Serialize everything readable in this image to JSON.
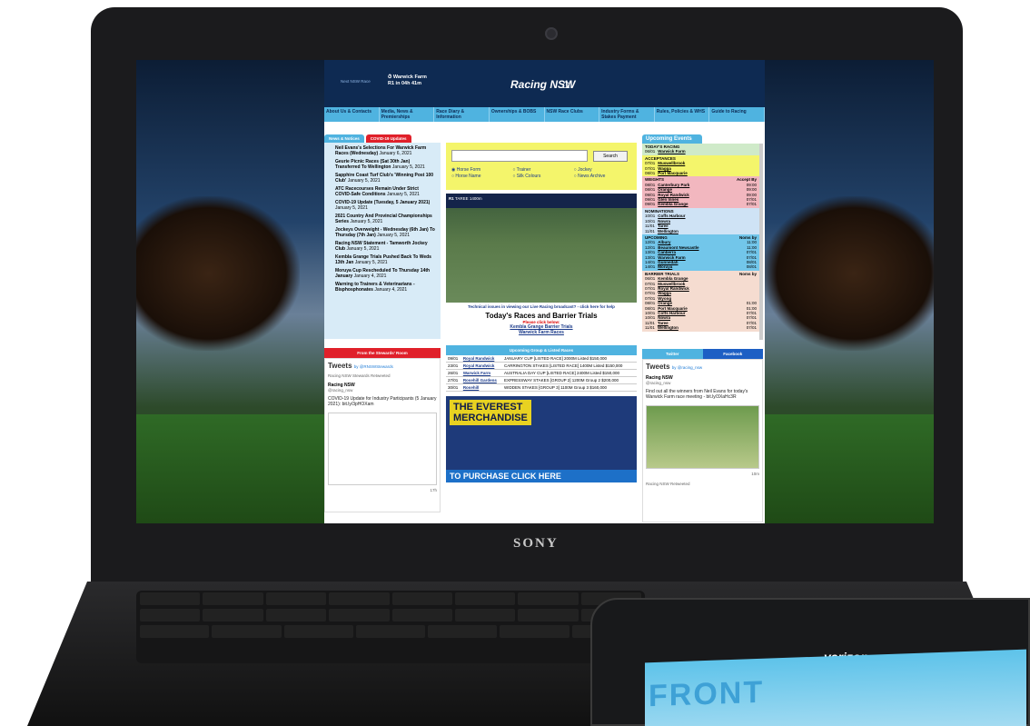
{
  "hardware": {
    "brand": "SONY",
    "carrier": "verizon",
    "phone_screen_text": "FRONT"
  },
  "header": {
    "next_race_label": "Next NSW Race",
    "next_race_venue": "Warwick Farm",
    "next_race_time": "R1 in 04h 41m",
    "logo_text": "Racing NSW"
  },
  "nav": [
    "About Us & Contacts",
    "Media, News & Premierships",
    "Race Diary & Information",
    "Ownerships & BOBS",
    "NSW Race Clubs",
    "Industry Forms & Stakes Payment",
    "Rules, Policies & WHS",
    "Guide to Racing"
  ],
  "news": {
    "tabs": [
      "News & Notices",
      "COVID-19 Updates"
    ],
    "items": [
      {
        "title": "Neil Evans's Selections For Warwick Farm Races (Wednesday)",
        "date": "January 6, 2021"
      },
      {
        "title": "Geurie Picnic Races (Sat 30th Jan) Transferred To Wellington",
        "date": "January 5, 2021"
      },
      {
        "title": "Sapphire Coast Turf Club's 'Winning Post 100 Club'",
        "date": "January 5, 2021"
      },
      {
        "title": "ATC Racecourses Remain Under Strict COVID-Safe Conditions",
        "date": "January 5, 2021"
      },
      {
        "title": "COVID-19 Update (Tuesday, 5 January 2021)",
        "date": "January 5, 2021"
      },
      {
        "title": "2021 Country And Provincial Championships Series",
        "date": "January 5, 2021"
      },
      {
        "title": "Jockeys Overweight - Wednesday (6th Jan) To Thursday (7th Jan)",
        "date": "January 5, 2021"
      },
      {
        "title": "Racing NSW Statement - Tamworth Jockey Club",
        "date": "January 5, 2021"
      },
      {
        "title": "Kembla Grange Trials Pushed Back To Weds 13th Jan",
        "date": "January 5, 2021"
      },
      {
        "title": "Moruya Cup Rescheduled To Thursday 14th January",
        "date": "January 4, 2021"
      },
      {
        "title": "Warning to Trainers & Veterinarians - Bisphosphonates",
        "date": "January 4, 2021"
      }
    ]
  },
  "search": {
    "button": "Search",
    "options": [
      "Horse Form",
      "Trainer",
      "Jockey",
      "Horse Name",
      "Silk Colours",
      "News Archive"
    ]
  },
  "video": {
    "race_label": "R1",
    "track": "TAREE",
    "distance": "1400m"
  },
  "live": {
    "notice": "Technical issues in viewing our Live Racing broadcast? - click here for help",
    "title": "Today's Races and Barrier Trials",
    "sub": "Please click below:",
    "links": [
      "Kembla Grange Barrier Trials",
      "Warwick Farm Races"
    ]
  },
  "upcoming": {
    "heading": "Upcoming Events",
    "sections": [
      {
        "name": "TODAY'S RACING",
        "right": "",
        "color": "#cfeac9",
        "rows": [
          [
            "06/01",
            "Warwick Farm",
            ""
          ]
        ]
      },
      {
        "name": "ACCEPTANCES",
        "right": "",
        "color": "#f4f56b",
        "rows": [
          [
            "07/01",
            "Muswellbrook",
            ""
          ],
          [
            "07/01",
            "Wagga",
            ""
          ],
          [
            "08/01",
            "Port Macquarie",
            ""
          ]
        ]
      },
      {
        "name": "WEIGHTS",
        "right": "Accept By",
        "color": "#f2b7bf",
        "rows": [
          [
            "08/01",
            "Canterbury Park",
            "09:00"
          ],
          [
            "08/01",
            "Orange",
            "09:00"
          ],
          [
            "09/01",
            "Royal Randwick",
            "09:00"
          ],
          [
            "09/01",
            "Glen Innes",
            "07/01"
          ],
          [
            "09/01",
            "Kembla Grange",
            "07/01"
          ]
        ]
      },
      {
        "name": "NOMINATIONS",
        "right": "",
        "color": "#cfe3f5",
        "rows": [
          [
            "10/01",
            "Coffs Harbour",
            ""
          ],
          [
            "10/01",
            "Nowra",
            ""
          ],
          [
            "11/01",
            "Taree",
            ""
          ],
          [
            "11/01",
            "Wellington",
            ""
          ]
        ]
      },
      {
        "name": "UPCOMING",
        "right": "Noms by",
        "color": "#72c6ea",
        "rows": [
          [
            "12/01",
            "Albury",
            "11:00"
          ],
          [
            "12/01",
            "Beaumont Newcastle",
            "11:00"
          ],
          [
            "13/01",
            "Canberra",
            "07/01"
          ],
          [
            "13/01",
            "Warwick Farm",
            "07/01"
          ],
          [
            "14/01",
            "Gunnedah",
            "08/01"
          ],
          [
            "14/01",
            "Moruya",
            "08/01"
          ]
        ]
      },
      {
        "name": "BARRIER TRIALS",
        "right": "Noms by",
        "color": "#f5dcd0",
        "rows": [
          [
            "06/01",
            "Kembla Grange",
            ""
          ],
          [
            "07/01",
            "Muswellbrook",
            ""
          ],
          [
            "07/01",
            "Royal Randwick",
            ""
          ],
          [
            "07/01",
            "Wagga",
            ""
          ],
          [
            "07/01",
            "Wyong",
            ""
          ],
          [
            "08/01",
            "Orange",
            "01:00"
          ],
          [
            "08/01",
            "Port Macquarie",
            "01:00"
          ],
          [
            "10/01",
            "Coffs Harbour",
            "07/01"
          ],
          [
            "10/01",
            "Nowra",
            "07/01"
          ],
          [
            "11/01",
            "Taree",
            "07/01"
          ],
          [
            "11/01",
            "Wellington",
            "07/01"
          ]
        ]
      }
    ]
  },
  "stewards": {
    "heading": "From the Stewards' Room",
    "tweets_title": "Tweets",
    "tweets_by": "by @RNSWStewards",
    "retweet": "Racing NSW Stewards Retweeted",
    "account": "Racing NSW",
    "handle": "@racing_nsw",
    "body": "COVID-19 Update for Industry Participants (5 January 2021): bit.ly/3pHOXam",
    "time": "17h"
  },
  "listed": {
    "heading": "Upcoming Group & Listed Races",
    "rows": [
      [
        "09/01",
        "Royal Randwick",
        "JANUARY CUP [LISTED RACE] 2000M Listed $150,000"
      ],
      [
        "23/01",
        "Royal Randwick",
        "CARRINGTON STAKES [LISTED RACE] 1400M Listed $150,000"
      ],
      [
        "26/01",
        "Warwick Farm",
        "AUSTRALIA DAY CUP [LISTED RACE] 2400M Listed $150,000"
      ],
      [
        "27/01",
        "Rosehill Gardens",
        "EXPRESSWAY STAKES [GROUP 2] 1200M Group 2 $200,000"
      ],
      [
        "30/01",
        "Rosehill",
        "WIDDEN STAKES [GROUP 3] 1100M Group 3 $160,000"
      ]
    ]
  },
  "merch": {
    "line1": "THE EVEREST",
    "line2": "MERCHANDISE",
    "cta": "TO PURCHASE CLICK HERE"
  },
  "social": {
    "tabs": [
      "Twitter",
      "Facebook"
    ],
    "tweets_title": "Tweets",
    "tweets_by": "by @racing_nsw",
    "account": "Racing NSW",
    "handle": "@racing_nsw",
    "body": "Find out all the winners from Neil Evans for today's Warwick Farm race meeting - bit.ly/3XaHc3R",
    "time": "10m",
    "retweet": "Racing NSW Retweeted"
  }
}
